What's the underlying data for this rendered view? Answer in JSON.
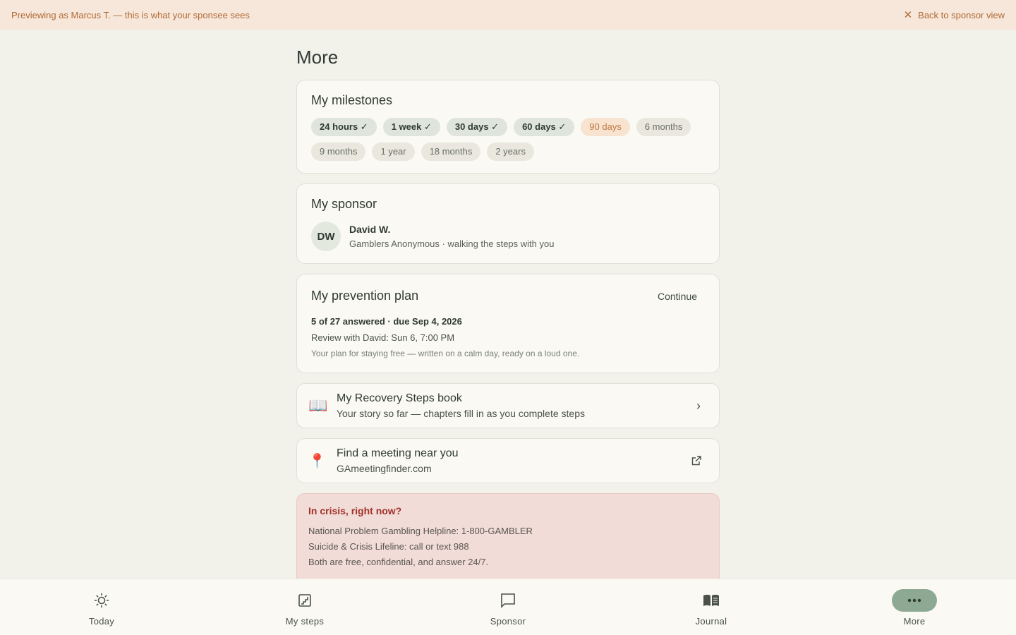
{
  "banner": {
    "preview_text": "Previewing as Marcus T. — this is what your sponsee sees",
    "back_label": "Back to sponsor view"
  },
  "page": {
    "title": "More"
  },
  "milestones": {
    "title": "My milestones",
    "chips": [
      {
        "label": "24 hours ✓",
        "state": "done"
      },
      {
        "label": "1 week ✓",
        "state": "done"
      },
      {
        "label": "30 days ✓",
        "state": "done"
      },
      {
        "label": "60 days ✓",
        "state": "done"
      },
      {
        "label": "90 days",
        "state": "next"
      },
      {
        "label": "6 months",
        "state": "future"
      },
      {
        "label": "9 months",
        "state": "future"
      },
      {
        "label": "1 year",
        "state": "future"
      },
      {
        "label": "18 months",
        "state": "future"
      },
      {
        "label": "2 years",
        "state": "future"
      }
    ]
  },
  "sponsor": {
    "title": "My sponsor",
    "initials": "DW",
    "name": "David W.",
    "subtitle": "Gamblers Anonymous · walking the steps with you"
  },
  "plan": {
    "title": "My prevention plan",
    "action": "Continue",
    "progress": "5 of 27 answered · due Sep 4, 2026",
    "review": "Review with David: Sun 6, 7:00 PM",
    "note": "Your plan for staying free — written on a calm day, ready on a loud one."
  },
  "book": {
    "title": "My Recovery Steps book",
    "subtitle": "Your story so far — chapters fill in as you complete steps",
    "icon": "open-book-icon"
  },
  "meeting": {
    "title": "Find a meeting near you",
    "subtitle": "GAmeetingfinder.com",
    "icon": "pin-icon"
  },
  "crisis": {
    "title": "In crisis, right now?",
    "lines": [
      "National Problem Gambling Helpline: 1-800-GAMBLER",
      "Suicide & Crisis Lifeline: call or text 988",
      "Both are free, confidential, and answer 24/7."
    ]
  },
  "nav": {
    "items": [
      {
        "label": "Today",
        "icon": "sun-icon"
      },
      {
        "label": "My steps",
        "icon": "steps-icon"
      },
      {
        "label": "Sponsor",
        "icon": "chat-icon"
      },
      {
        "label": "Journal",
        "icon": "journal-icon"
      },
      {
        "label": "More",
        "icon": "more-icon"
      }
    ],
    "active": "More"
  },
  "colors": {
    "background": "#f2f1ea",
    "banner": "#f7e7da",
    "accent": "#8ea993",
    "crisis_title": "#a3332b"
  }
}
